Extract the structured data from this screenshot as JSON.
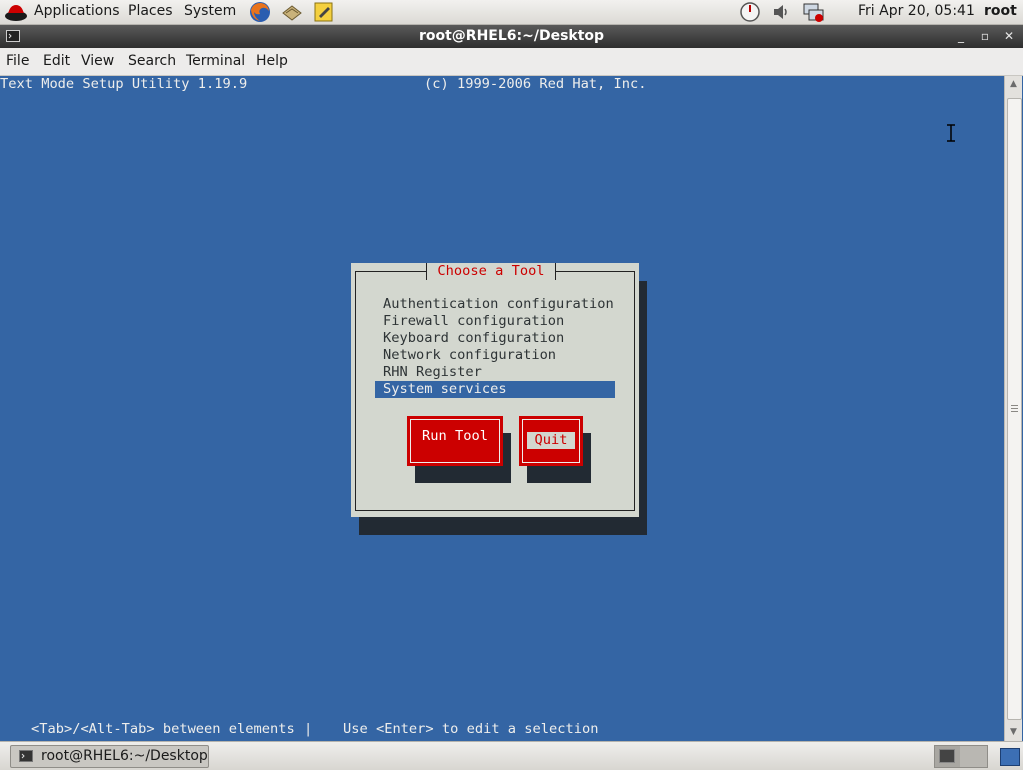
{
  "top_panel": {
    "menus": [
      "Applications",
      "Places",
      "System"
    ],
    "clock": "Fri Apr 20, 05:41",
    "user": "root"
  },
  "window": {
    "title": "root@RHEL6:~/Desktop"
  },
  "menubar": {
    "items": [
      "File",
      "Edit",
      "View",
      "Search",
      "Terminal",
      "Help"
    ]
  },
  "terminal": {
    "header_left": "Text Mode Setup Utility 1.19.9",
    "header_right": "(c) 1999-2006 Red Hat, Inc.",
    "footer_left": "<Tab>/<Alt-Tab> between elements",
    "footer_sep": "|",
    "footer_right": "Use <Enter> to edit a selection"
  },
  "dialog": {
    "title": "Choose a Tool",
    "tools": [
      "Authentication configuration",
      "Firewall configuration",
      "Keyboard configuration",
      "Network configuration",
      "RHN Register",
      "System services"
    ],
    "selected_tool": "System services",
    "run_label": "Run Tool",
    "quit_label": "Quit"
  },
  "taskbar": {
    "task_label": "root@RHEL6:~/Desktop"
  },
  "colors": {
    "terminal_bg": "#3465a4",
    "dialog_bg": "#d3d7cf",
    "button_red": "#cc0000",
    "shadow": "#222a33"
  }
}
